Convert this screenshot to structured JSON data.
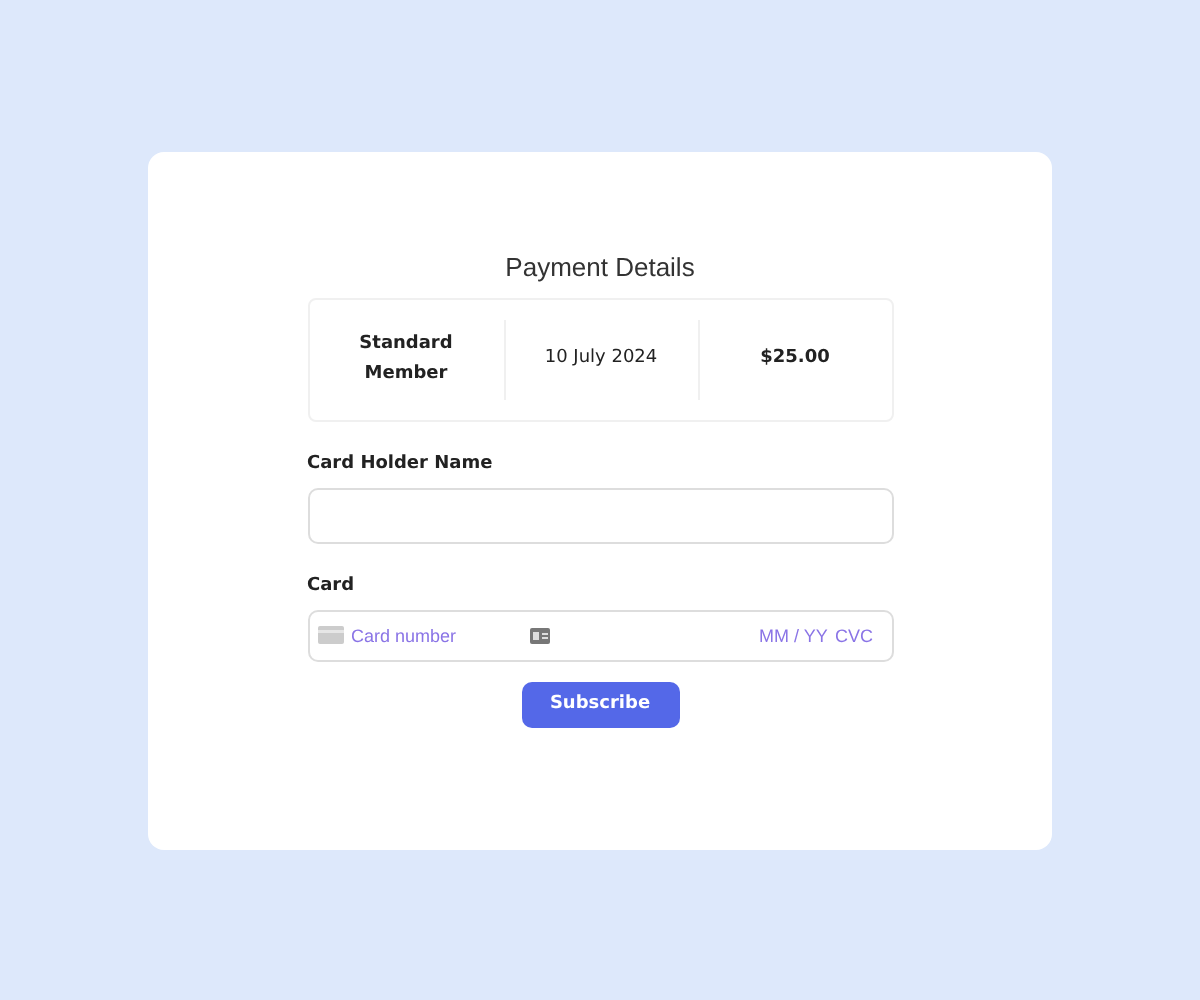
{
  "title": "Payment Details",
  "summary": [
    {
      "text": "Standard Member",
      "bold": true
    },
    {
      "text": "10 July 2024",
      "bold": false
    },
    {
      "text": "$25.00",
      "bold": true
    }
  ],
  "holder": {
    "label": "Card Holder Name"
  },
  "card": {
    "label": "Card",
    "number_placeholder": "Card number",
    "expiry_placeholder": "MM / YY",
    "cvc_placeholder": "CVC"
  },
  "button": "Subscribe"
}
